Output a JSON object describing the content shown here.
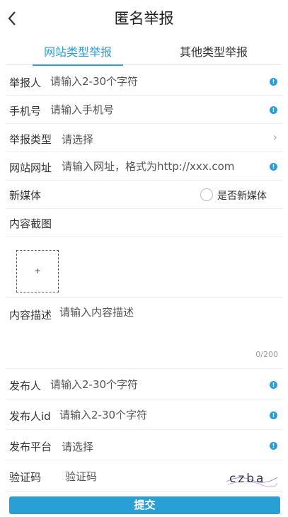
{
  "header": {
    "title": "匿名举报"
  },
  "tabs": [
    {
      "label": "网站类型举报"
    },
    {
      "label": "其他类型举报"
    }
  ],
  "form": {
    "reporter": {
      "label": "举报人",
      "placeholder": "请输入2-30个字符"
    },
    "phone": {
      "label": "手机号",
      "placeholder": "请输入手机号"
    },
    "report_type": {
      "label": "举报类型",
      "value": "请选择"
    },
    "website": {
      "label": "网站网址",
      "placeholder": "请输入网址，格式为http://xxx.com"
    },
    "new_media": {
      "label": "新媒体",
      "option_label": "是否新媒体"
    },
    "screenshot": {
      "label": "内容截图",
      "upload_label": "+"
    },
    "description": {
      "label": "内容描述",
      "placeholder": "请输入内容描述",
      "counter": "0/200"
    },
    "publisher": {
      "label": "发布人",
      "placeholder": "请输入2-30个字符"
    },
    "publisher_id": {
      "label": "发布人id",
      "placeholder": "请输入2-30个字符"
    },
    "platform": {
      "label": "发布平台",
      "value": "请选择"
    },
    "captcha": {
      "label": "验证码",
      "placeholder": "验证码",
      "image_text": "czba"
    }
  },
  "submit_label": "提交",
  "info_glyph": "!"
}
